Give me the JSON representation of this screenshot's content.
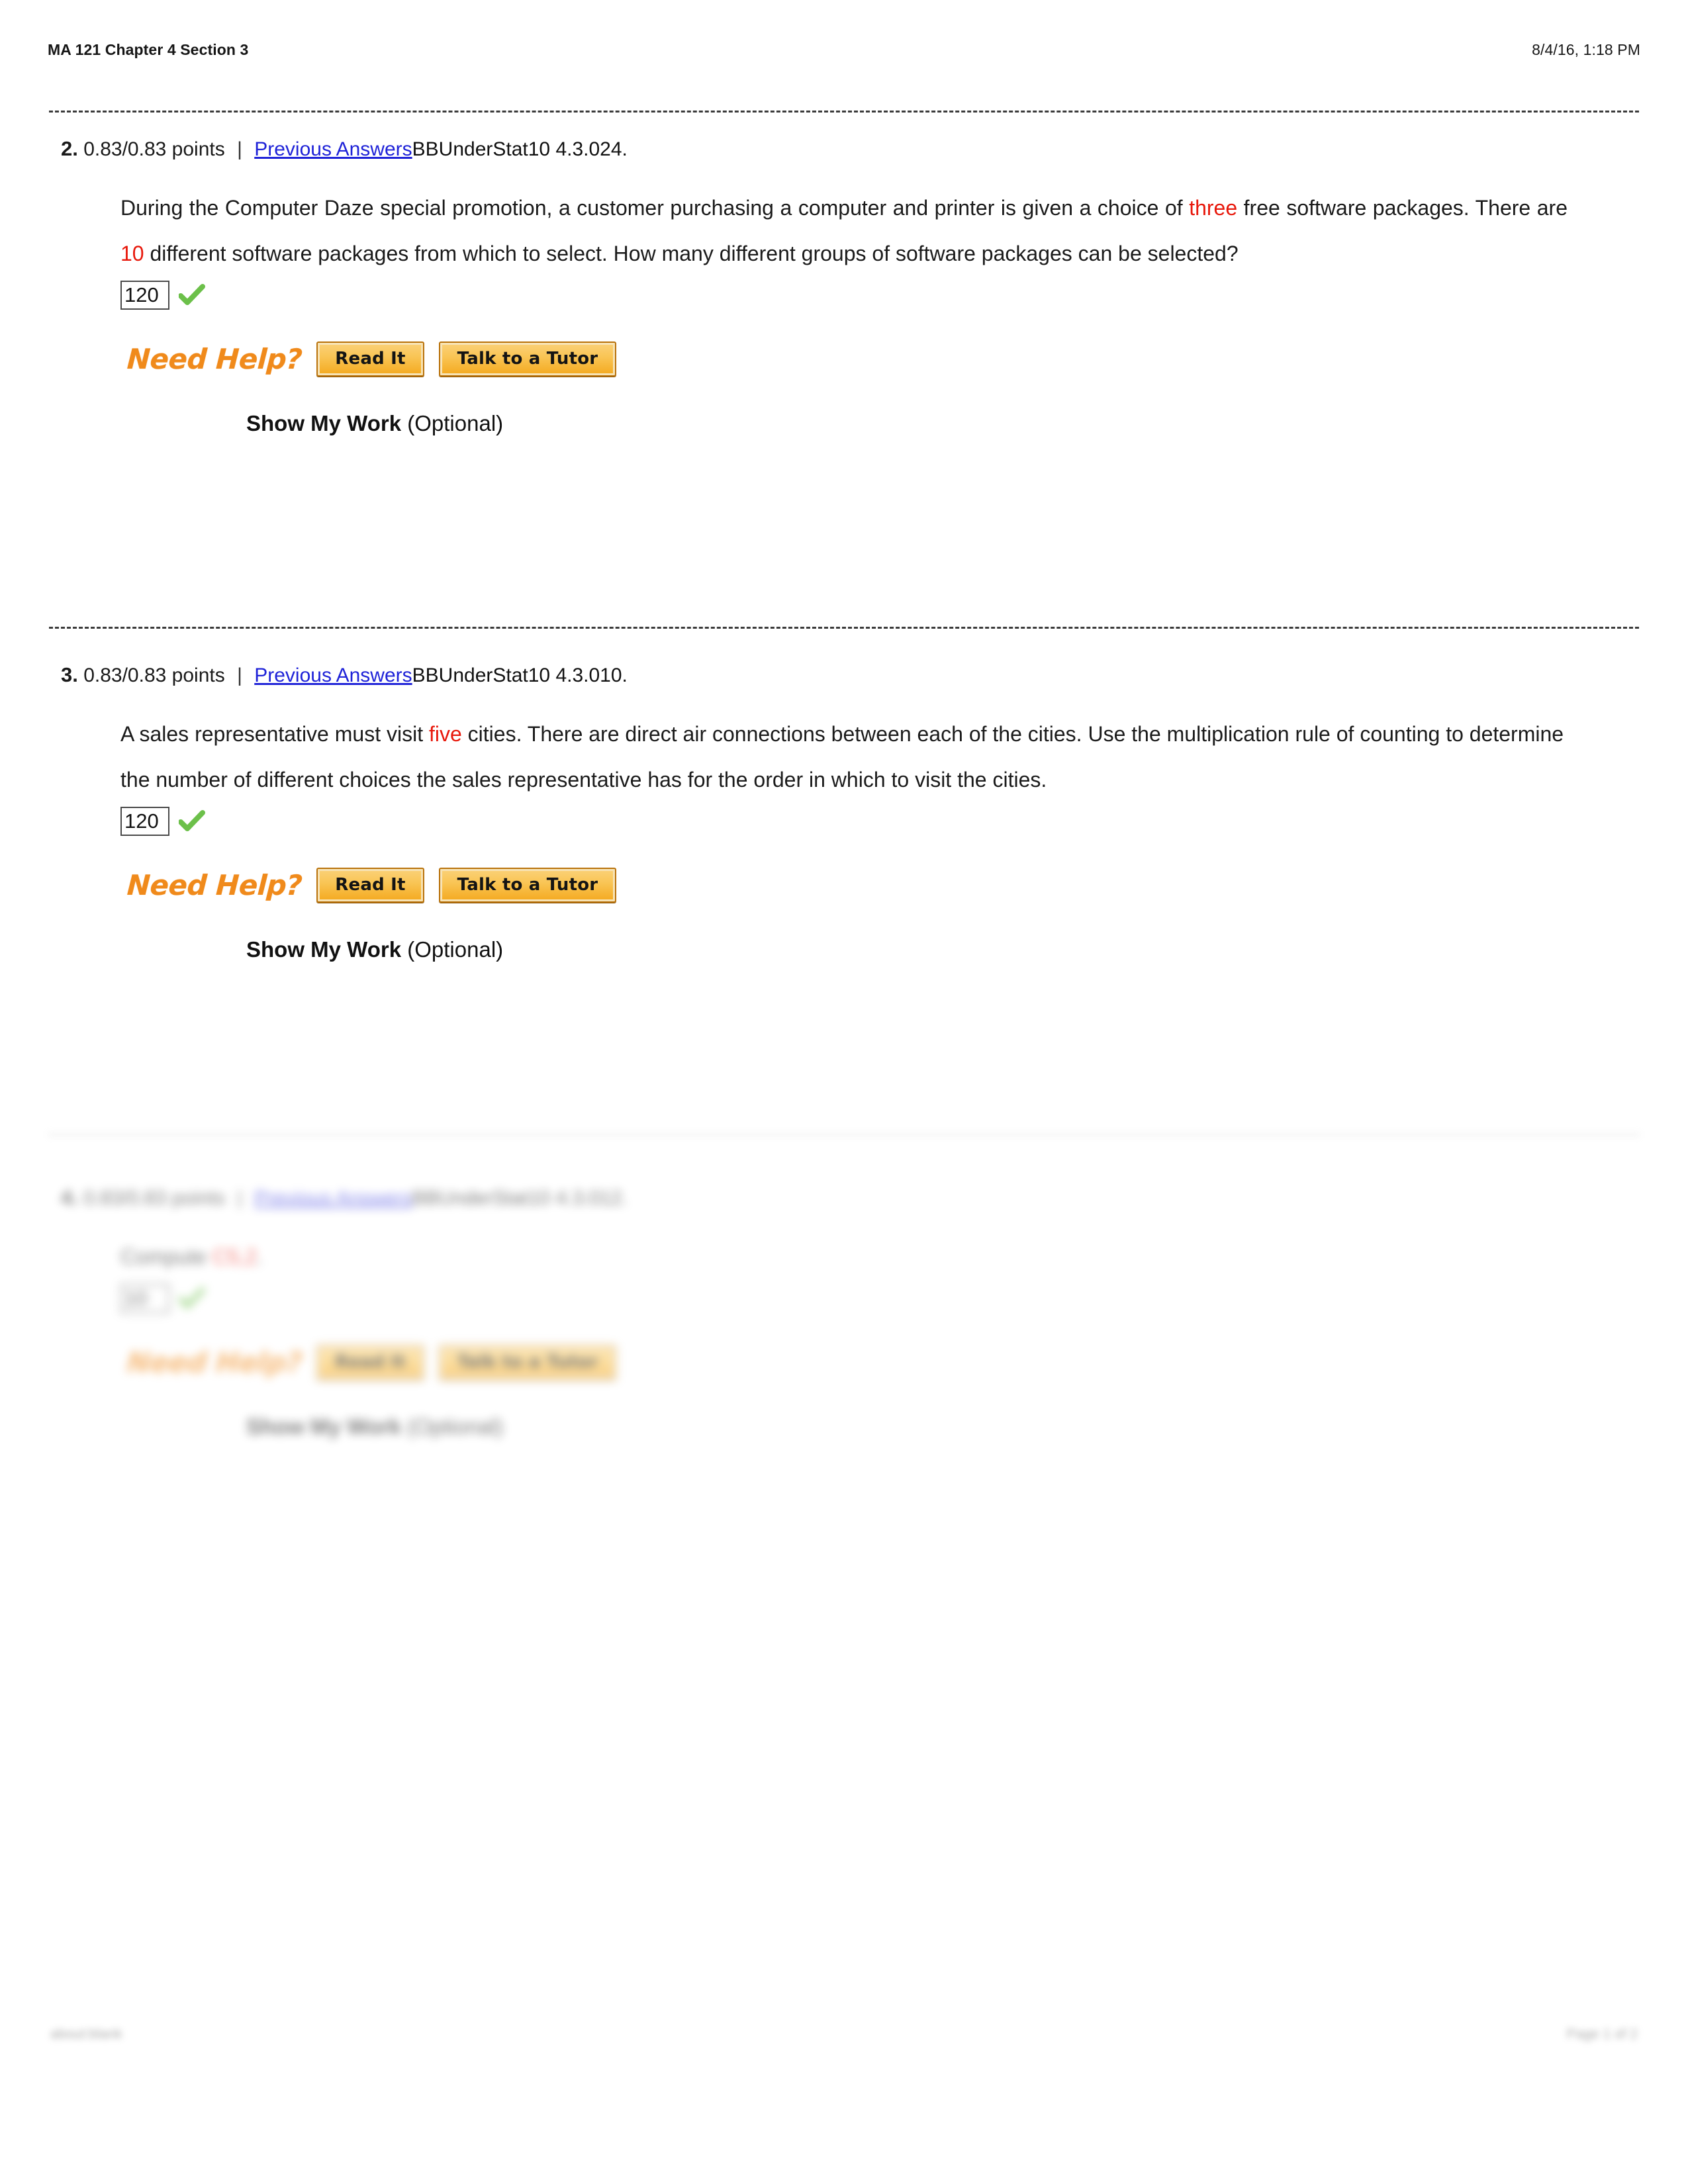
{
  "print_header": {
    "title": "MA 121 Chapter 4 Section 3",
    "timestamp": "8/4/16, 1:18 PM"
  },
  "print_footer": {
    "left": "about:blank",
    "right": "Page 1 of 2"
  },
  "colors": {
    "link": "#1f23d8",
    "highlight_red": "#e8190c",
    "need_help_orange": "#f08a1b",
    "button_face": "#f9c453",
    "button_border": "#b9720b",
    "check_green": "#6cc04a"
  },
  "labels": {
    "previous_answers": "Previous Answers",
    "pipe": "|",
    "points_suffix": "points",
    "need_help": "Need Help?",
    "read_it": "Read It",
    "talk_to_tutor": "Talk to a Tutor",
    "show_my_work": "Show My Work",
    "optional": "(Optional)",
    "check_icon": "green-checkmark-icon"
  },
  "questions": [
    {
      "number": "2.",
      "points": "0.83/0.83",
      "code": "BBUnderStat10 4.3.024.",
      "text_parts": [
        {
          "t": "During the Computer Daze special promotion, a customer purchasing a computer and printer is given a choice of ",
          "red": false
        },
        {
          "t": "three",
          "red": true
        },
        {
          "t": " free software packages. There are ",
          "red": false
        },
        {
          "t": "10",
          "red": true
        },
        {
          "t": " different software packages from which to select. How many different groups of software packages can be selected?",
          "red": false
        }
      ],
      "answer": "120",
      "answer_status": "correct"
    },
    {
      "number": "3.",
      "points": "0.83/0.83",
      "code": "BBUnderStat10 4.3.010.",
      "text_parts": [
        {
          "t": "A sales representative must visit ",
          "red": false
        },
        {
          "t": "five",
          "red": true
        },
        {
          "t": " cities. There are direct air connections between each of the cities. Use the multiplication rule of counting to determine the number of different choices the sales representative has for the order in which to visit the cities.",
          "red": false
        }
      ],
      "answer": "120",
      "answer_status": "correct"
    },
    {
      "number": "4.",
      "points": "0.83/0.83",
      "code": "BBUnderStat10 4.3.012.",
      "text_parts": [
        {
          "t": "Compute ",
          "red": false
        },
        {
          "t": "C5,2",
          "red": true
        },
        {
          "t": ".",
          "red": false
        }
      ],
      "answer": "10",
      "answer_status": "correct"
    }
  ]
}
